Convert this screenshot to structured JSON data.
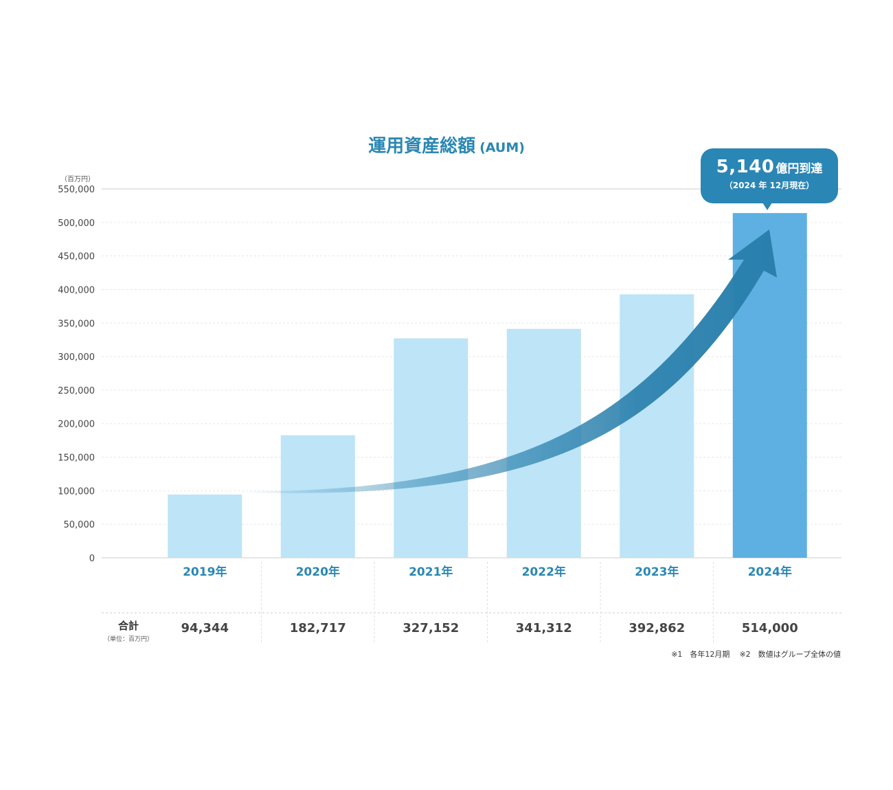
{
  "title": {
    "main": "運用資産総額",
    "sub": "(AUM)"
  },
  "unit_label": "（百万円）",
  "callout": {
    "headline_value": "5,140",
    "headline_text": "億円到達",
    "subtext": "（2024 年 12月現在）"
  },
  "total_row": {
    "label": "合計",
    "sublabel": "（単位：百万円）"
  },
  "footnotes": [
    "※1　各年12月期",
    "※2　数値はグループ全体の値"
  ],
  "colors": {
    "bar": "#bde4f7",
    "bar_highlight": "#5eb0e2",
    "accent": "#2a87b3",
    "arrow": "#2a80ad"
  },
  "chart_data": {
    "type": "bar",
    "categories": [
      "2019年",
      "2020年",
      "2021年",
      "2022年",
      "2023年",
      "2024年"
    ],
    "values": [
      94344,
      182717,
      327152,
      341312,
      392862,
      514000
    ],
    "value_labels": [
      "94,344",
      "182,717",
      "327,152",
      "341,312",
      "392,862",
      "514,000"
    ],
    "ylim": [
      0,
      550000
    ],
    "yticks": [
      0,
      50000,
      100000,
      150000,
      200000,
      250000,
      300000,
      350000,
      400000,
      450000,
      500000,
      550000
    ],
    "ytick_labels": [
      "0",
      "50,000",
      "100,000",
      "150,000",
      "200,000",
      "250,000",
      "300,000",
      "350,000",
      "400,000",
      "450,000",
      "500,000",
      "550,000"
    ],
    "grid": true,
    "highlight_index": 5
  }
}
